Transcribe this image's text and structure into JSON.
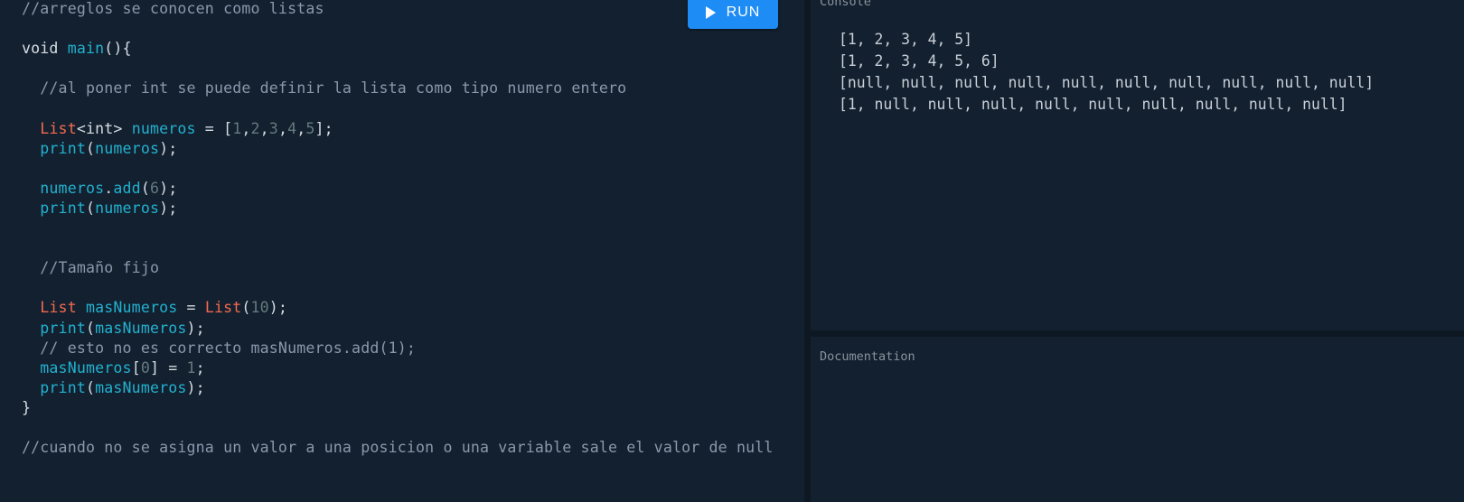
{
  "editor": {
    "run_label": "RUN",
    "lines": [
      [
        [
          "comment",
          "//arreglos se conocen como listas"
        ]
      ],
      [],
      [
        [
          "plain",
          "void "
        ],
        [
          "fn",
          "main"
        ],
        [
          "plain",
          "(){"
        ]
      ],
      [],
      [
        [
          "plain",
          "  "
        ],
        [
          "comment",
          "//al poner int se puede definir la lista como tipo numero entero"
        ]
      ],
      [],
      [
        [
          "plain",
          "  "
        ],
        [
          "type",
          "List"
        ],
        [
          "plain",
          "<int> "
        ],
        [
          "fn",
          "numeros"
        ],
        [
          "plain",
          " = ["
        ],
        [
          "num",
          "1"
        ],
        [
          "plain",
          ","
        ],
        [
          "num",
          "2"
        ],
        [
          "plain",
          ","
        ],
        [
          "num",
          "3"
        ],
        [
          "plain",
          ","
        ],
        [
          "num",
          "4"
        ],
        [
          "plain",
          ","
        ],
        [
          "num",
          "5"
        ],
        [
          "plain",
          "];"
        ]
      ],
      [
        [
          "plain",
          "  "
        ],
        [
          "fn",
          "print"
        ],
        [
          "plain",
          "("
        ],
        [
          "fn",
          "numeros"
        ],
        [
          "plain",
          ");"
        ]
      ],
      [],
      [
        [
          "plain",
          "  "
        ],
        [
          "fn",
          "numeros"
        ],
        [
          "plain",
          "."
        ],
        [
          "fn",
          "add"
        ],
        [
          "plain",
          "("
        ],
        [
          "num",
          "6"
        ],
        [
          "plain",
          ");"
        ]
      ],
      [
        [
          "plain",
          "  "
        ],
        [
          "fn",
          "print"
        ],
        [
          "plain",
          "("
        ],
        [
          "fn",
          "numeros"
        ],
        [
          "plain",
          ");"
        ]
      ],
      [],
      [],
      [
        [
          "plain",
          "  "
        ],
        [
          "comment",
          "//Tamaño fijo"
        ]
      ],
      [],
      [
        [
          "plain",
          "  "
        ],
        [
          "type",
          "List"
        ],
        [
          "plain",
          " "
        ],
        [
          "fn",
          "masNumeros"
        ],
        [
          "plain",
          " = "
        ],
        [
          "type",
          "List"
        ],
        [
          "plain",
          "("
        ],
        [
          "num",
          "10"
        ],
        [
          "plain",
          ");"
        ]
      ],
      [
        [
          "plain",
          "  "
        ],
        [
          "fn",
          "print"
        ],
        [
          "plain",
          "("
        ],
        [
          "fn",
          "masNumeros"
        ],
        [
          "plain",
          ");"
        ]
      ],
      [
        [
          "plain",
          "  "
        ],
        [
          "comment",
          "// esto no es correcto masNumeros.add(1);"
        ]
      ],
      [
        [
          "plain",
          "  "
        ],
        [
          "fn",
          "masNumeros"
        ],
        [
          "plain",
          "["
        ],
        [
          "num",
          "0"
        ],
        [
          "plain",
          "] = "
        ],
        [
          "num",
          "1"
        ],
        [
          "plain",
          ";"
        ]
      ],
      [
        [
          "plain",
          "  "
        ],
        [
          "fn",
          "print"
        ],
        [
          "plain",
          "("
        ],
        [
          "fn",
          "masNumeros"
        ],
        [
          "plain",
          ");"
        ]
      ],
      [
        [
          "plain",
          "}"
        ]
      ],
      [],
      [
        [
          "comment",
          "//cuando no se asigna un valor a una posicion o una variable sale el valor de null"
        ]
      ]
    ]
  },
  "console": {
    "title": "Console",
    "output": [
      "[1, 2, 3, 4, 5]",
      "[1, 2, 3, 4, 5, 6]",
      "[null, null, null, null, null, null, null, null, null, null]",
      "[1, null, null, null, null, null, null, null, null, null]"
    ]
  },
  "documentation": {
    "title": "Documentation"
  },
  "colors": {
    "background": "#13202f",
    "run_button": "#1e8cf5",
    "function": "#22b1cf",
    "type": "#f26a50",
    "comment": "#8a98ac",
    "number": "#667a7e"
  }
}
